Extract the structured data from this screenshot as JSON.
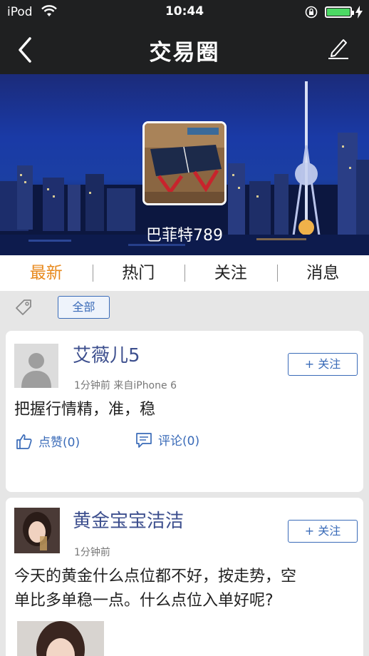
{
  "status_bar": {
    "carrier": "iPod",
    "time": "10:44"
  },
  "nav": {
    "title": "交易圈",
    "back_icon": "chevron-left-icon",
    "edit_icon": "pencil-icon"
  },
  "banner": {
    "user_name": "巴菲特789"
  },
  "tabs": [
    {
      "label": "最新",
      "active": true
    },
    {
      "label": "热门",
      "active": false
    },
    {
      "label": "关注",
      "active": false
    },
    {
      "label": "消息",
      "active": false
    }
  ],
  "filter": {
    "chip_label": "全部"
  },
  "posts": [
    {
      "author": "艾薇儿5",
      "meta": "1分钟前 来自iPhone 6",
      "follow_label": "+ 关注",
      "content": "把握行情精，准，稳",
      "like_label": "点赞(0)",
      "comment_label": "评论(0)"
    },
    {
      "author": "黄金宝宝洁洁",
      "meta": "1分钟前",
      "follow_label": "+ 关注",
      "content_line1": "今天的黄金什么点位都不好，按走势，空",
      "content_line2": "单比多单稳一点。什么点位入单好呢?"
    }
  ],
  "colors": {
    "accent": "#e8891c",
    "link": "#3a6bb8",
    "nav_bg": "#1f2021",
    "name": "#3d4f8e"
  }
}
